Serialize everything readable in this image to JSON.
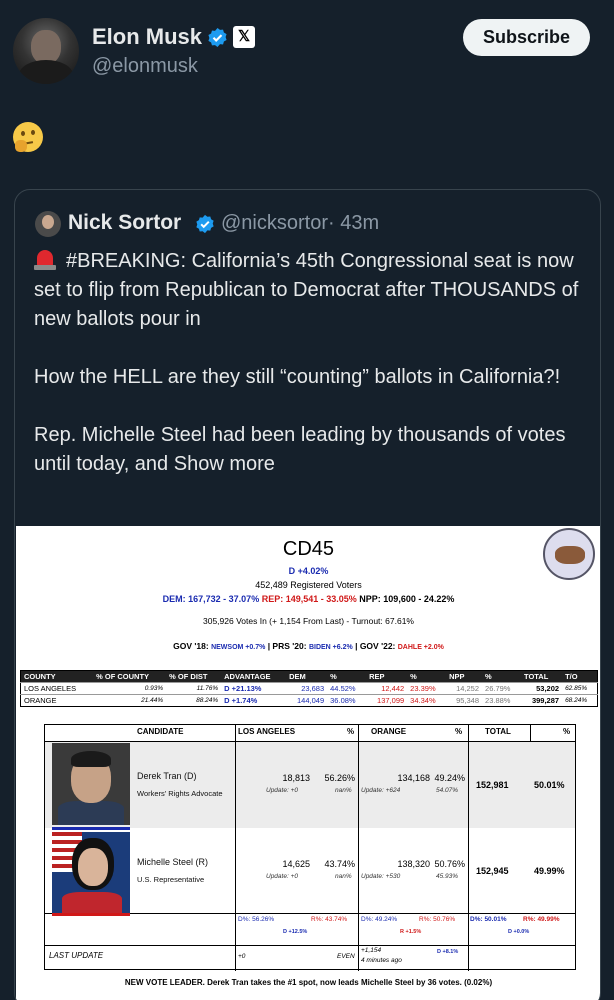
{
  "author": {
    "name": "Elon Musk",
    "handle": "@elonmusk",
    "x_badge": "𝕏"
  },
  "subscribe_label": "Subscribe",
  "tweet_emoji": "thinking-face",
  "quote": {
    "name": "Nick Sortor",
    "handle": "@nicksortor",
    "time": "· 43m",
    "text_1": "#BREAKING: California’s 45th Congressional seat is now set to flip from Republican to Democrat after THOUSANDS of new ballots pour in",
    "text_2": "How the HELL are they still “counting” ballots in California?!",
    "text_3": "Rep. Michelle Steel had been leading by thousands of votes until today, and",
    "show_more": "Show more"
  },
  "image": {
    "title": "CD45",
    "advantage": "D +4.02%",
    "registered": "452,489 Registered Voters",
    "dem_total": "DEM: 167,732 - 37.07%",
    "rep_total": "REP: 149,541 - 33.05%",
    "npp_total": "NPP: 109,600 - 24.22%",
    "votes_in": "305,926 Votes In (+ 1,154 From Last) - Turnout: 67.61%",
    "prev_gov18": "GOV '18: ",
    "prev_gov18_v": "NEWSOM +0.7%",
    "prev_prs20": " | PRS '20: ",
    "prev_prs20_v": "BIDEN +6.2%",
    "prev_gov22": " | GOV '22: ",
    "prev_gov22_v": "DAHLE +2.0%",
    "county_headers": [
      "COUNTY",
      "% OF COUNTY",
      "% OF DIST",
      "ADVANTAGE",
      "DEM",
      "%",
      "REP",
      "%",
      "NPP",
      "%",
      "TOTAL",
      "T/O"
    ],
    "counties": [
      {
        "county": "LOS ANGELES",
        "pct_county": "0.93%",
        "pct_dist": "11.76%",
        "adv": "D +21.13%",
        "dem": "23,683",
        "dem_pct": "44.52%",
        "rep": "12,442",
        "rep_pct": "23.39%",
        "npp": "14,252",
        "npp_pct": "26.79%",
        "total": "53,202",
        "to": "62.85%"
      },
      {
        "county": "ORANGE",
        "pct_county": "21.44%",
        "pct_dist": "88.24%",
        "adv": "D +1.74%",
        "dem": "144,049",
        "dem_pct": "36.08%",
        "rep": "137,099",
        "rep_pct": "34.34%",
        "npp": "95,348",
        "npp_pct": "23.88%",
        "total": "399,287",
        "to": "68.24%"
      }
    ],
    "cand_headers": [
      "CANDIDATE",
      "LOS ANGELES",
      "%",
      "ORANGE",
      "%",
      "TOTAL",
      "%"
    ],
    "candidates": [
      {
        "name": "Derek Tran (D)",
        "role": "Workers' Rights Advocate",
        "la": "18,813",
        "la_pct": "56.26%",
        "la_upd": "Update: +0",
        "la_upd_pct": "nan%",
        "or": "134,168",
        "or_pct": "49.24%",
        "or_upd": "Update: +624",
        "or_upd_pct": "54.07%",
        "total": "152,981",
        "total_pct": "50.01%"
      },
      {
        "name": "Michelle Steel (R)",
        "role": "U.S. Representative",
        "la": "14,625",
        "la_pct": "43.74%",
        "la_upd": "Update: +0",
        "la_upd_pct": "nan%",
        "or": "138,320",
        "or_pct": "50.76%",
        "or_upd": "Update: +530",
        "or_upd_pct": "45.93%",
        "total": "152,945",
        "total_pct": "49.99%"
      }
    ],
    "foot": {
      "la_d": "D%: 56.26%",
      "la_r": "R%: 43.74%",
      "la_shift": "D +12.5%",
      "or_d": "D%: 49.24%",
      "or_r": "R%: 50.76%",
      "or_shift": "R +1.5%",
      "tot_d": "D%: 50.01%",
      "tot_r": "R%: 49.99%",
      "tot_shift": "D +0.0%",
      "last_update": "LAST UPDATE",
      "lu_la": "+0",
      "lu_even": "EVEN",
      "lu_or": "+1,154",
      "lu_or_ago": "4 minutes ago",
      "lu_or_shift": "D +8.1%"
    },
    "note": "NEW VOTE LEADER. Derek Tran takes the #1 spot, now leads Michelle Steel by 36 votes. (0.02%)"
  }
}
